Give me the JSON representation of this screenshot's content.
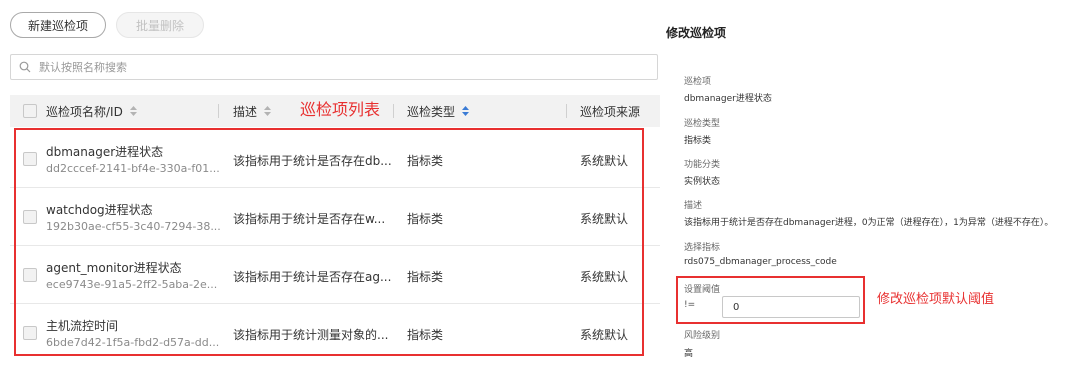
{
  "toolbar": {
    "new_label": "新建巡检项",
    "batch_delete_label": "批量删除"
  },
  "search": {
    "placeholder": "默认按照名称搜索"
  },
  "table": {
    "columns": [
      "巡检项名称/ID",
      "描述",
      "巡检类型",
      "巡检项来源"
    ],
    "rows": [
      {
        "name": "dbmanager进程状态",
        "id": "dd2cccef-2141-bf4e-330a-f01...",
        "description": "该指标用于统计是否存在db...",
        "type": "指标类",
        "source": "系统默认"
      },
      {
        "name": "watchdog进程状态",
        "id": "192b30ae-cf55-3c40-7294-38...",
        "description": "该指标用于统计是否存在w...",
        "type": "指标类",
        "source": "系统默认"
      },
      {
        "name": "agent_monitor进程状态",
        "id": "ece9743e-91a5-2ff2-5aba-2e...",
        "description": "该指标用于统计是否存在ag...",
        "type": "指标类",
        "source": "系统默认"
      },
      {
        "name": "主机流控时间",
        "id": "6bde7d42-1f5a-fbd2-d57a-dd...",
        "description": "该指标用于统计测量对象的...",
        "type": "指标类",
        "source": "系统默认"
      }
    ]
  },
  "annotations": {
    "list_title": "巡检项列表",
    "threshold_title": "修改巡检项默认阈值",
    "color": "#e83030"
  },
  "edit_panel": {
    "title": "修改巡检项",
    "item_label": "巡检项",
    "item_value": "dbmanager进程状态",
    "type_label": "巡检类型",
    "type_value": "指标类",
    "category_label": "功能分类",
    "category_value": "实例状态",
    "desc_label": "描述",
    "desc_value": "该指标用于统计是否存在dbmanager进程，0为正常（进程存在），1为异常（进程不存在）。",
    "metric_label": "选择指标",
    "metric_value": "rds075_dbmanager_process_code",
    "threshold_label": "设置阈值",
    "threshold_operator": "!=",
    "threshold_value": "0",
    "risk_label": "风险级别",
    "risk_value": "高"
  },
  "colors": {
    "accent_blue": "#3a7bd5",
    "header_bg": "#f2f2f2"
  }
}
